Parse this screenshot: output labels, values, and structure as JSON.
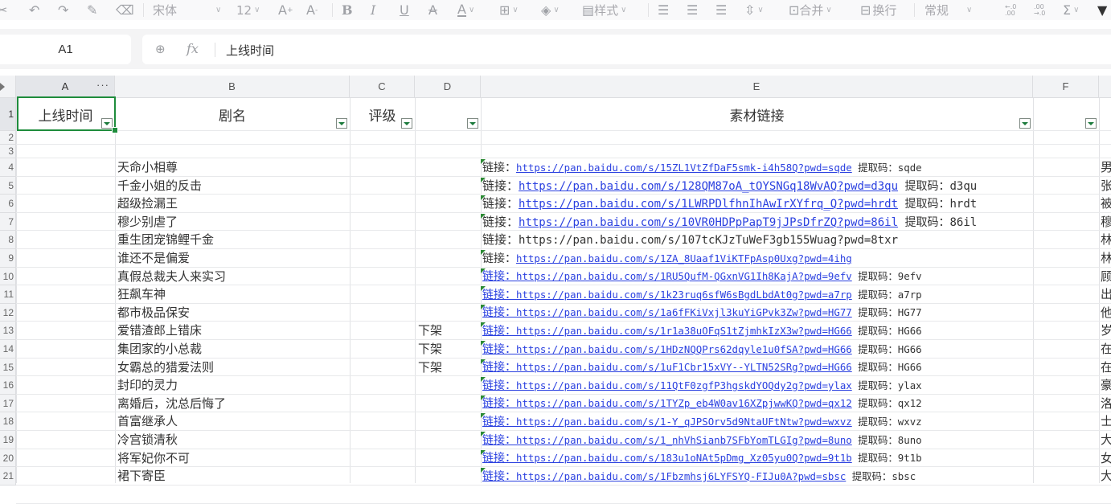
{
  "toolbar": {
    "font_name": "宋体",
    "font_size": "12",
    "style_label": "样式",
    "merge_label": "合并",
    "wrap_label": "换行",
    "number_format": "常规",
    "icons": [
      "undo-icon",
      "redo-icon",
      "format-painter-icon",
      "eraser-icon",
      "font-grow-icon",
      "font-shrink-icon",
      "bold-icon",
      "italic-icon",
      "underline-icon",
      "strikethrough-icon",
      "font-color-icon",
      "border-icon",
      "fill-color-icon",
      "style-icon",
      "align-left-icon",
      "align-center-icon",
      "align-right-icon",
      "vertical-align-icon",
      "merge-icon",
      "wrap-icon",
      "increase-decimal-icon",
      "decrease-decimal-icon",
      "sum-icon",
      "filter-icon"
    ]
  },
  "namebox": {
    "value": "A1"
  },
  "formula": {
    "fx": "fx",
    "value": "上线时间"
  },
  "columns": [
    "A",
    "B",
    "C",
    "D",
    "E",
    "F"
  ],
  "col_a_more": "···",
  "rows": [
    "1",
    "2",
    "3",
    "4",
    "5",
    "6",
    "7",
    "8",
    "9",
    "10",
    "11",
    "12",
    "13",
    "14",
    "15",
    "16",
    "17",
    "18",
    "19",
    "20",
    "21"
  ],
  "header": {
    "a": "上线时间",
    "b": "剧名",
    "c": "评级",
    "d": "",
    "e": "素材链接",
    "f": ""
  },
  "data_rows": [
    {
      "name": "天命小相尊",
      "d": "",
      "label": "链接：",
      "url": "https://pan.baidu.com/s/15ZL1VtZfDaF5smk-i4h58Q?pwd=sqde",
      "code_label": "提取码：",
      "code": "sqde",
      "g": "男"
    },
    {
      "name": "千金小姐的反击",
      "d": "",
      "label": "链接：",
      "url": "https://pan.baidu.com/s/128QM87oA_tOYSNGq18WvAQ?pwd=d3qu",
      "code_label": "提取码：",
      "code": "d3qu",
      "g": "张"
    },
    {
      "name": "超级捡漏王",
      "d": "",
      "label": "链接：",
      "url": "https://pan.baidu.com/s/1LWRPDlfhnIhAwIrXYfrq_Q?pwd=hrdt",
      "code_label": "提取码：",
      "code": "hrdt",
      "g": "被"
    },
    {
      "name": "穆少别虐了",
      "d": "",
      "label": "链接：",
      "url": "https://pan.baidu.com/s/10VR0HDPpPapT9jJPsDfrZQ?pwd=86il",
      "code_label": "提取码：",
      "code": "86il",
      "g": "穆"
    },
    {
      "name": "重生团宠锦鲤千金",
      "d": "",
      "label": "链接：",
      "url": "https://pan.baidu.com/s/107tcKJzTuWeF3gb155Wuag?pwd=8txr",
      "code_label": "",
      "code": "",
      "g": "林"
    },
    {
      "name": "谁还不是偏爱",
      "d": "",
      "label": "链接：",
      "url": "https://pan.baidu.com/s/1ZA_8Uaaf1ViKTFpAsp0Uxg?pwd=4ihg",
      "code_label": "",
      "code": "",
      "g": "林"
    },
    {
      "name": "真假总裁夫人来实习",
      "d": "",
      "label": "链接：",
      "url": "https://pan.baidu.com/s/1RU5QufM-QGxnVG1Ih8KajA?pwd=9efv",
      "code_label": "提取码：",
      "code": "9efv",
      "g": "顾"
    },
    {
      "name": "狂飙车神",
      "d": "",
      "label": "链接：",
      "url": "https://pan.baidu.com/s/1k23ruq6sfW6sBgdLbdAt0g?pwd=a7rp",
      "code_label": "提取码：",
      "code": "a7rp",
      "g": "出"
    },
    {
      "name": "都市极品保安",
      "d": "",
      "label": "链接：",
      "url": "https://pan.baidu.com/s/1a6fFKiVxjl3kuYiGPvk3Zw?pwd=HG77",
      "code_label": "提取码：",
      "code": "HG77",
      "g": "他"
    },
    {
      "name": "爱错渣郎上错床",
      "d": "下架",
      "label": "链接：",
      "url": "https://pan.baidu.com/s/1r1a38uOFqS1tZjmhkIzX3w?pwd=HG66",
      "code_label": "提取码：",
      "code": "HG66",
      "g": "岁"
    },
    {
      "name": "集团家的小总裁",
      "d": "下架",
      "label": "链接：",
      "url": "https://pan.baidu.com/s/1HDzNQQPrs62dqyle1u0fSA?pwd=HG66",
      "code_label": "提取码：",
      "code": "HG66",
      "g": "在"
    },
    {
      "name": "女霸总的猎爱法则",
      "d": "下架",
      "label": "链接：",
      "url": "https://pan.baidu.com/s/1uF1Cbr15xVY--YLTN52SRg?pwd=HG66",
      "code_label": "提取码：",
      "code": "HG66",
      "g": "在"
    },
    {
      "name": "封印的灵力",
      "d": "",
      "label": "链接：",
      "url": "https://pan.baidu.com/s/11QtF0zgfP3hgskdYOQdy2g?pwd=ylax",
      "code_label": "提取码：",
      "code": "ylax",
      "g": "豪"
    },
    {
      "name": "离婚后，沈总后悔了",
      "d": "",
      "label": "链接：",
      "url": "https://pan.baidu.com/s/1TYZp_eb4W0av16XZpjwwKQ?pwd=qx12",
      "code_label": "提取码：",
      "code": "qx12",
      "g": "洛"
    },
    {
      "name": "首富继承人",
      "d": "",
      "label": "链接：",
      "url": "https://pan.baidu.com/s/1-Y_qJPSOrv5d9NtaUFtNtw?pwd=wxvz",
      "code_label": "提取码：",
      "code": "wxvz",
      "g": "士"
    },
    {
      "name": "冷宫锁清秋",
      "d": "",
      "label": "链接：",
      "url": "https://pan.baidu.com/s/1_nhVhSianb7SFbYomTLGIg?pwd=8uno",
      "code_label": "提取码：",
      "code": "8uno",
      "g": "大"
    },
    {
      "name": "将军妃你不可",
      "d": "",
      "label": "链接：",
      "url": "https://pan.baidu.com/s/183u1oNAt5pDmg_Xz05yu0Q?pwd=9t1b",
      "code_label": "提取码：",
      "code": "9t1b",
      "g": "女"
    },
    {
      "name": "裙下寄臣",
      "d": "",
      "label": "链接：",
      "url": "https://pan.baidu.com/s/1Fbzmhsj6LYFSYQ-FIJu0A?pwd=sbsc",
      "code_label": "提取码：",
      "code": "sbsc",
      "g": "大"
    }
  ]
}
